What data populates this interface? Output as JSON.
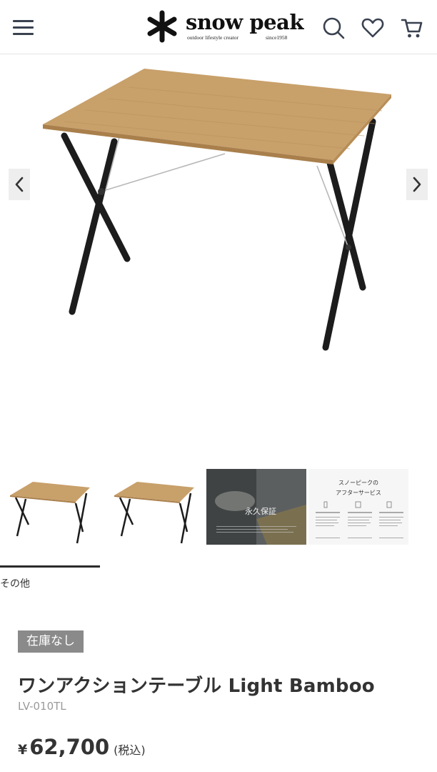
{
  "header": {
    "brand_name": "snow peak",
    "brand_tagline": "outdoor lifestyle creator",
    "brand_since": "since1958",
    "icons": [
      "menu-icon",
      "search-icon",
      "heart-icon",
      "cart-icon"
    ]
  },
  "gallery": {
    "prev_icon": "chevron-left-icon",
    "next_icon": "chevron-right-icon",
    "thumbnails": [
      {
        "name": "thumbnail-table-1"
      },
      {
        "name": "thumbnail-table-2"
      },
      {
        "name": "thumbnail-warranty",
        "text": "永久保証"
      },
      {
        "name": "thumbnail-after-service",
        "title_line1": "スノーピークの",
        "title_line2": "アフターサービス"
      }
    ],
    "selected_caption": "その他"
  },
  "product": {
    "stock_status": "在庫なし",
    "title": "ワンアクションテーブル Light Bamboo",
    "code": "LV-010TL",
    "price_symbol": "¥",
    "price": "62,700",
    "tax_note": "(税込)"
  },
  "colors": {
    "badge_bg": "#8a8a8a",
    "text": "#333333",
    "subtext": "#9a9a9a",
    "bamboo": "#c8a06a",
    "frame": "#1c1c1c"
  }
}
